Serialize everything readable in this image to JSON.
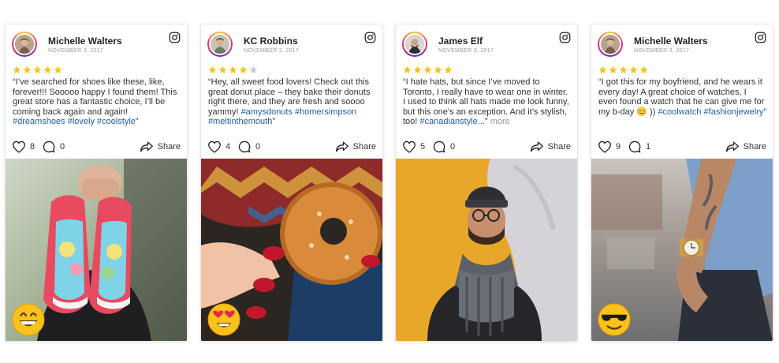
{
  "cards": [
    {
      "name": "Michelle Walters",
      "date": "NOVEMBER 3, 2017",
      "rating": 5,
      "quote_open": "“",
      "text": "I’ve searched for shoes like these, like, forever!!! Sooooo happy I found them! This great store has a fantastic choice, I’ll be coming back again and again! ",
      "tags": "#dreamshoes #lovely #coolstyle",
      "more": "",
      "quote_close": "”",
      "likes": "8",
      "comments": "0",
      "share_label": "Share",
      "photo_icon": "shoes-photo",
      "emoji_icon": "grinning-face-emoji"
    },
    {
      "name": "KC Robbins",
      "date": "NOVEMBER 3, 2017",
      "rating": 4,
      "quote_open": "“",
      "text": "Hey, all sweet food lovers! Check out this great donut place – they bake their donuts right there, and they are fresh and soooo yammy! ",
      "tags": "#amysdonuts #homersimpson #meltinthemouth",
      "more": "",
      "quote_close": "”",
      "likes": "4",
      "comments": "0",
      "share_label": "Share",
      "photo_icon": "donut-photo",
      "emoji_icon": "heart-eyes-emoji"
    },
    {
      "name": "James Elf",
      "date": "NOVEMBER 3, 2017",
      "rating": 5,
      "quote_open": "“",
      "text": "I hate hats, but since I’ve moved to Toronto, I really have to wear one in winter. I used to think all hats made me look funny, but this one’s an exception. And it’s stylish, too! ",
      "tags": "#canadianstyle...",
      "more": "more",
      "quote_close": "”",
      "likes": "5",
      "comments": "0",
      "share_label": "Share",
      "photo_icon": "man-in-hat-photo",
      "emoji_icon": ""
    },
    {
      "name": "Michelle Walters",
      "date": "NOVEMBER 3, 2017",
      "rating": 5,
      "quote_open": "“",
      "text": "I got this for my boyfriend, and he wears it every day! A great choice of watches, I even found a watch that he can give me for my b-day 😊 )) ",
      "tags": "#coolwatch #fashionjewelry",
      "more": "",
      "quote_close": "”",
      "likes": "9",
      "comments": "1",
      "share_label": "Share",
      "photo_icon": "wristwatch-photo",
      "emoji_icon": "sunglasses-face-emoji"
    }
  ],
  "colors": {
    "star": "#f5c518",
    "star_empty": "#cccccc",
    "hashtag": "#1f5fa8",
    "instagram_ring": "#ee2a7b"
  }
}
